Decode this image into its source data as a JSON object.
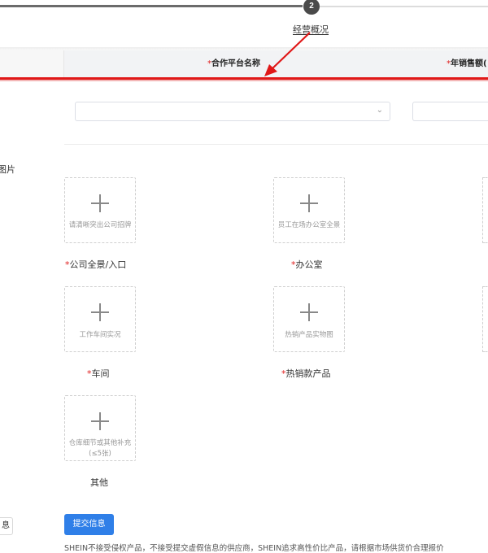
{
  "stepper": {
    "current_step": "2",
    "current_label": "经营概况"
  },
  "table_header": {
    "col1": "合作平台名称",
    "col2": "年销售额(",
    "required_mark": "*"
  },
  "select": {
    "chevron": "⌄"
  },
  "side_text": "图片",
  "uploads": [
    {
      "hint": "请清晰突出公司招牌",
      "label": "公司全景/入口",
      "required": "*"
    },
    {
      "hint": "员工在场办公室全景",
      "label": "办公室",
      "required": "*"
    },
    {
      "hint": "工作车间实况",
      "label": "车间",
      "required": "*"
    },
    {
      "hint": "热销产品实物图",
      "label": "热销款产品",
      "required": "*"
    },
    {
      "hint": "仓库细节或其他补充(≤5张)",
      "label": "其他",
      "required": ""
    }
  ],
  "buttons": {
    "submit": "提交信息",
    "left_partial": "息"
  },
  "notice": "SHEIN不接受侵权产品，不接受提交虚假信息的供应商，SHEIN追求高性价比产品，请根据市场供货价合理报价"
}
